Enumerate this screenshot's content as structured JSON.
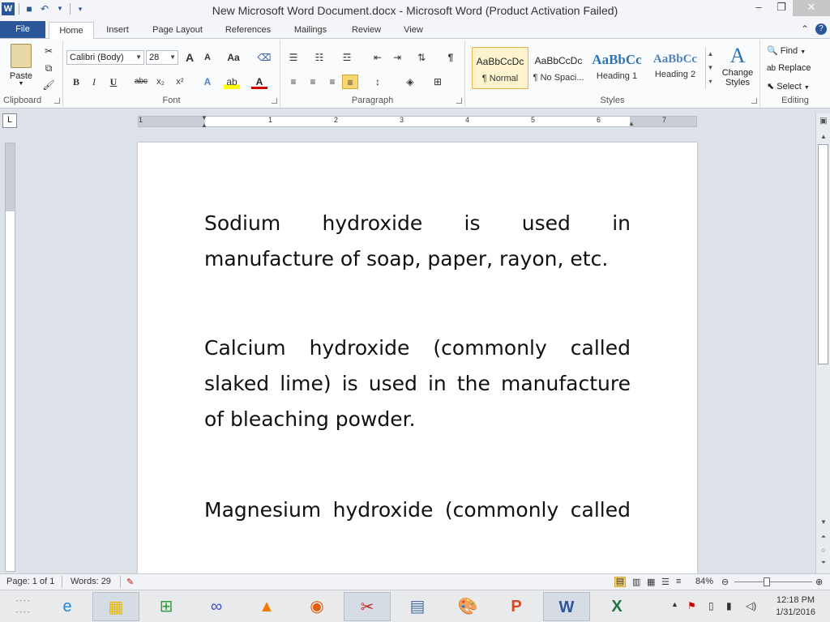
{
  "titlebar": {
    "title": "New Microsoft Word Document.docx  -  Microsoft Word (Product Activation Failed)",
    "minimize": "–",
    "restore": "❐",
    "close": "✕"
  },
  "ribbon_tabs": [
    "File",
    "Home",
    "Insert",
    "Page Layout",
    "References",
    "Mailings",
    "Review",
    "View"
  ],
  "clipboard": {
    "paste": "Paste",
    "group": "Clipboard"
  },
  "font": {
    "name": "Calibri (Body)",
    "size": "28",
    "group": "Font",
    "grow": "A",
    "shrink": "A",
    "change_case": "Aa",
    "bold": "B",
    "italic": "I",
    "underline": "U",
    "strike": "abc",
    "sub": "x₂",
    "sup": "x²",
    "color": "A"
  },
  "paragraph": {
    "group": "Paragraph",
    "pilcrow": "¶"
  },
  "styles": {
    "group": "Styles",
    "items": [
      {
        "sample": "AaBbCcDc",
        "name": "¶ Normal"
      },
      {
        "sample": "AaBbCcDc",
        "name": "¶ No Spaci..."
      },
      {
        "sample": "AaBbCc",
        "name": "Heading 1"
      },
      {
        "sample": "AaBbCc",
        "name": "Heading 2"
      }
    ],
    "change_styles": "Change Styles"
  },
  "editing": {
    "group": "Editing",
    "find": "Find",
    "replace": "Replace",
    "select": "Select"
  },
  "ruler": {
    "numbers": [
      "1",
      "1",
      "2",
      "3",
      "4",
      "5",
      "6",
      "7"
    ]
  },
  "document": {
    "paragraphs": [
      {
        "lines": [
          "Sodium hydroxide is used in",
          "manufacture of soap, paper, rayon, etc."
        ]
      },
      {
        "lines": [
          "Calcium hydroxide (commonly called",
          "slaked lime) is used in the manufacture",
          "of bleaching powder."
        ]
      },
      {
        "lines": [
          "Magnesium hydroxide (commonly called"
        ]
      }
    ]
  },
  "status": {
    "page": "Page: 1 of 1",
    "words": "Words: 29",
    "zoom": "84%",
    "zoom_level": 0.84
  },
  "taskbar": {
    "clock_time": "12:18 PM",
    "clock_date": "1/31/2016"
  }
}
